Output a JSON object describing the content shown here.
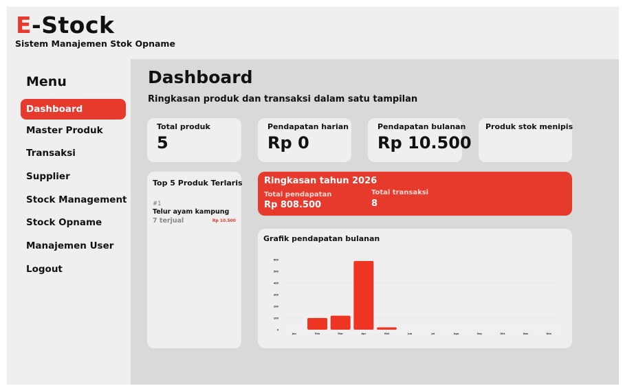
{
  "header": {
    "logo_e": "E",
    "logo_rest": "-Stock",
    "subtitle": "Sistem Manajemen Stok Opname"
  },
  "sidebar": {
    "title": "Menu",
    "items": [
      {
        "label": "Dashboard",
        "active": true
      },
      {
        "label": "Master Produk",
        "active": false
      },
      {
        "label": "Transaksi",
        "active": false
      },
      {
        "label": "Supplier",
        "active": false
      },
      {
        "label": "Stock Management",
        "active": false
      },
      {
        "label": "Stock Opname",
        "active": false
      },
      {
        "label": "Manajemen User",
        "active": false
      },
      {
        "label": "Logout",
        "active": false
      }
    ]
  },
  "main": {
    "title": "Dashboard",
    "subtitle": "Ringkasan produk dan transaksi dalam satu tampilan"
  },
  "cards": [
    {
      "label": "Total produk",
      "value": "5"
    },
    {
      "label": "Pendapatan harian",
      "value": "Rp 0"
    },
    {
      "label": "Pendapatan bulanan",
      "value": "Rp 10.500"
    },
    {
      "label": "Produk stok menipis",
      "value": ""
    }
  ],
  "top5": {
    "title": "Top 5 Produk Terlaris",
    "items": [
      {
        "rank": "#1",
        "name": "Telur ayam kampung",
        "sold": "7 terjual",
        "price": "Rp 10.500"
      }
    ]
  },
  "summary": {
    "title": "Ringkasan tahun 2026",
    "revenue_label": "Total pendapatan",
    "revenue_value": "Rp 808.500",
    "transactions_label": "Total transaksi",
    "transactions_value": "8"
  },
  "chart_data": {
    "type": "bar",
    "title": "Grafik pendapatan bulanan",
    "categories": [
      "Jan",
      "Feb",
      "Mar",
      "Apr",
      "Mei",
      "Jun",
      "Jul",
      "Agu",
      "Sep",
      "Okt",
      "Nov",
      "Des"
    ],
    "values": [
      0,
      100000,
      120000,
      588000,
      20000,
      0,
      0,
      0,
      0,
      0,
      0,
      0
    ],
    "yticks": [
      "0",
      "100",
      "200",
      "300",
      "400",
      "500",
      "600"
    ],
    "ytick_values": [
      0,
      100000,
      200000,
      300000,
      400000,
      500000,
      600000
    ],
    "ylim": [
      0,
      600000
    ],
    "bar_color": "#ee3524",
    "grid": true
  },
  "colors": {
    "accent": "#e53a2c"
  }
}
